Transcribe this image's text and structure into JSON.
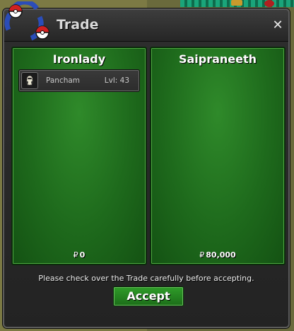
{
  "window": {
    "title": "Trade",
    "close_glyph": "✕",
    "logo_icon": "pokeball-arrows-icon",
    "close_icon": "close-icon"
  },
  "left_panel": {
    "player_name": "Ironlady",
    "items": [
      {
        "name": "Pancham",
        "level": "Lvl: 43",
        "icon": "pancham-sprite-icon"
      }
    ],
    "currency_symbol": "₽",
    "money": "0"
  },
  "right_panel": {
    "player_name": "Saipraneeth",
    "items": [],
    "currency_symbol": "₽",
    "money": "80,000"
  },
  "footer": {
    "notice": "Please check over the Trade carefully before accepting.",
    "accept_label": "Accept"
  },
  "colors": {
    "panel_green": "#1e6a1c",
    "accept_green": "#2f9c29",
    "window_dark": "#262626"
  }
}
